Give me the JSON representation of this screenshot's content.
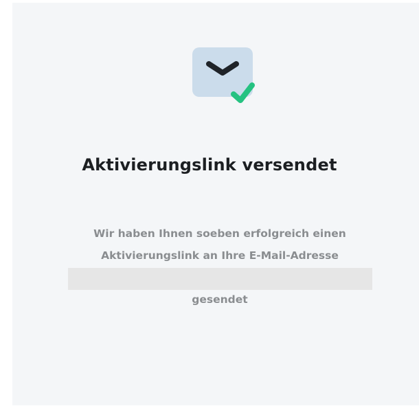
{
  "icon": {
    "name": "email-sent-check-icon",
    "envelope_color": "#cbdceb",
    "chevron_color": "#1f2328",
    "check_color": "#25c281"
  },
  "title": "Aktivierungslink versendet",
  "message": {
    "line1": "Wir haben Ihnen soeben erfolgreich einen",
    "line2": "Aktivierungslink an Ihre E-Mail-Adresse",
    "line3": "gesendet"
  },
  "colors": {
    "card_background": "#f4f6f8",
    "title": "#1c1f22",
    "message": "#8a8d90",
    "redacted_email": "#e6e6e6"
  }
}
